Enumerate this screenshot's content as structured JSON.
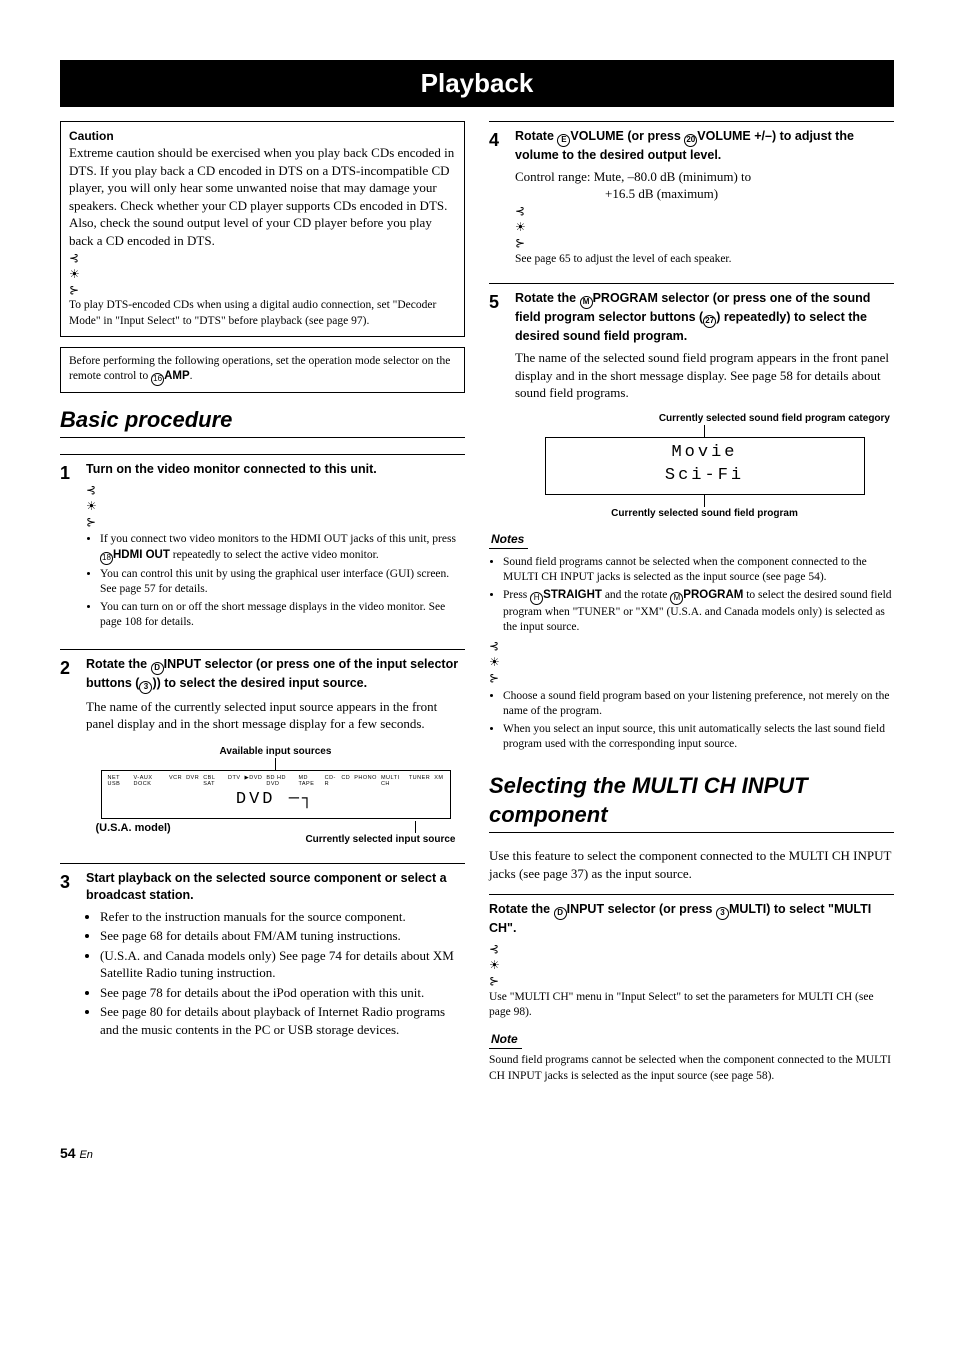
{
  "title": "Playback",
  "caution": {
    "label": "Caution",
    "text": "Extreme caution should be exercised when you play back CDs encoded in DTS. If you play back a CD encoded in DTS on a DTS-incompatible CD player, you will only hear some unwanted noise that may damage your speakers. Check whether your CD player supports CDs encoded in DTS. Also, check the sound output level of your CD player before you play back a CD encoded in DTS.",
    "tip": "To play DTS-encoded CDs when using a digital audio connection, set \"Decoder Mode\" in \"Input Select\" to \"DTS\" before playback (see page 97)."
  },
  "preface": {
    "before": "Before performing the following operations, set the operation mode selector on the remote control to ",
    "amp": "AMP",
    "period": "."
  },
  "section1": "Basic procedure",
  "steps": {
    "s1": {
      "num": "1",
      "title": "Turn on the video monitor connected to this unit.",
      "b1a": "If you connect two video monitors to the HDMI OUT jacks of this unit, press ",
      "b1b": "HDMI OUT",
      "b1c": " repeatedly to select the active video monitor.",
      "b2": "You can control this unit by using the graphical user interface (GUI) screen. See page 57 for details.",
      "b3": "You can turn on or off the short message displays in the video monitor. See page 108 for details."
    },
    "s2": {
      "num": "2",
      "title_a": "Rotate the ",
      "title_b": "INPUT",
      "title_c": " selector (or press one of the input selector buttons (",
      "title_d": ")) to select the desired input source.",
      "desc": "The name of the currently selected input source appears in the front panel display and in the short message display for a few seconds.",
      "cap1": "Available input sources",
      "labels": [
        "NET USB",
        "V-AUX DOCK",
        "VCR",
        "DVR",
        "CBL SAT",
        "DTV",
        "▶DVD",
        "BD HD DVD",
        "MD TAPE",
        "CD-R",
        "CD",
        "PHONO",
        "MULTI CH",
        "TUNER",
        "XM"
      ],
      "disp": "DVD",
      "usanote": "(U.S.A. model)",
      "cap2": "Currently selected input source"
    },
    "s3": {
      "num": "3",
      "title": "Start playback on the selected source component or select a broadcast station.",
      "b1": "Refer to the instruction manuals for the source component.",
      "b2": "See page 68 for details about FM/AM tuning instructions.",
      "b3": "(U.S.A. and Canada models only) See page 74 for details about XM Satellite Radio tuning instruction.",
      "b4": "See page 78 for details about the iPod operation with this unit.",
      "b5": "See page 80 for details about playback of Internet Radio programs and the music contents in the PC or USB storage devices."
    },
    "s4": {
      "num": "4",
      "title_a": "Rotate ",
      "title_b": "VOLUME",
      "title_c": " (or press ",
      "title_d": "VOLUME +/–",
      "title_e": ") to adjust the volume to the desired output level.",
      "desc1": "Control range: Mute, –80.0 dB (minimum) to",
      "desc2": "+16.5 dB (maximum)",
      "tip": "See page 65 to adjust the level of each speaker."
    },
    "s5": {
      "num": "5",
      "title_a": "Rotate the ",
      "title_b": "PROGRAM",
      "title_c": " selector (or press one of the sound field program selector buttons (",
      "title_d": ") repeatedly) to select the desired sound field program.",
      "desc": "The name of the selected sound field program appears in the front panel display and in the short message display. See page 58 for details about sound field programs.",
      "cap1": "Currently selected sound field program category",
      "line1": "Movie",
      "line2": "Sci-Fi",
      "cap2": "Currently selected sound field program"
    }
  },
  "notes1": {
    "label": "Notes",
    "n1": "Sound field programs cannot be selected when the component connected to the MULTI CH INPUT jacks is selected as the input source (see page 54).",
    "n2a": "Press ",
    "n2b": "STRAIGHT",
    "n2c": " and the rotate ",
    "n2d": "PROGRAM",
    "n2e": " to select the desired sound field program when \"TUNER\" or \"XM\" (U.S.A. and Canada models only) is selected as the input source.",
    "t1": "Choose a sound field program based on your listening preference, not merely on the name of the program.",
    "t2": "When you select an input source, this unit automatically selects the last sound field program used with the corresponding input source."
  },
  "section2": "Selecting the MULTI CH INPUT component",
  "multi": {
    "intro": "Use this feature to select the component connected to the MULTI CH INPUT jacks (see page 37) as the input source.",
    "instr_a": "Rotate the ",
    "instr_b": "INPUT",
    "instr_c": " selector (or press ",
    "instr_d": "MULTI",
    "instr_e": ") to select \"MULTI CH\".",
    "tip": "Use \"MULTI CH\" menu in \"Input Select\" to set the parameters for MULTI CH (see page 98).",
    "note_label": "Note",
    "note": "Sound field programs cannot be selected when the component connected to the MULTI CH INPUT jacks is selected as the input source (see page 58)."
  },
  "pagenum": "54",
  "pagelang": "En",
  "icons": {
    "tip": "⊰☀⊱",
    "c3": "3",
    "cD": "D",
    "cE": "E",
    "c20": "20",
    "cM": "M",
    "c27": "27",
    "cH": "H",
    "c16": "16",
    "c18": "18"
  }
}
